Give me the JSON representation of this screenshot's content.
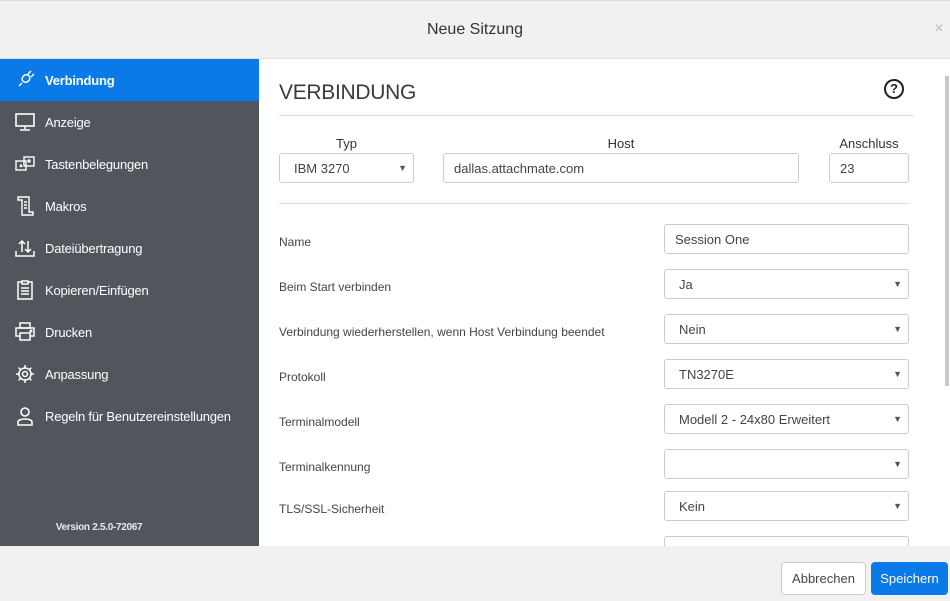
{
  "dialog": {
    "title": "Neue Sitzung",
    "close_symbol": "×"
  },
  "sidebar": {
    "items": [
      {
        "label": "Verbindung",
        "icon": "plug-icon",
        "active": true
      },
      {
        "label": "Anzeige",
        "icon": "monitor-icon",
        "active": false
      },
      {
        "label": "Tastenbelegungen",
        "icon": "keymap-icon",
        "active": false
      },
      {
        "label": "Makros",
        "icon": "scroll-icon",
        "active": false
      },
      {
        "label": "Dateiübertragung",
        "icon": "file-transfer-icon",
        "active": false
      },
      {
        "label": "Kopieren/Einfügen",
        "icon": "clipboard-icon",
        "active": false
      },
      {
        "label": "Drucken",
        "icon": "printer-icon",
        "active": false
      },
      {
        "label": "Anpassung",
        "icon": "gear-icon",
        "active": false
      },
      {
        "label": "Regeln für Benutzereinstellungen",
        "icon": "user-icon",
        "active": false
      }
    ],
    "version": "Version 2.5.0-72067"
  },
  "main": {
    "title": "VERBINDUNG",
    "help_symbol": "?",
    "type": {
      "label": "Typ",
      "value": "IBM 3270"
    },
    "host": {
      "label": "Host",
      "value": "dallas.attachmate.com"
    },
    "port": {
      "label": "Anschluss",
      "value": "23"
    },
    "rows": [
      {
        "label": "Name",
        "value": "Session One",
        "kind": "input"
      },
      {
        "label": "Beim Start verbinden",
        "value": "Ja",
        "kind": "select"
      },
      {
        "label": "Verbindung wiederherstellen, wenn Host Verbindung beendet",
        "value": "Nein",
        "kind": "select"
      },
      {
        "label": "Protokoll",
        "value": "TN3270E",
        "kind": "select"
      },
      {
        "label": "Terminalmodell",
        "value": "Modell 2 - 24x80 Erweitert",
        "kind": "select"
      },
      {
        "label": "Terminalkennung",
        "value": "",
        "kind": "select"
      },
      {
        "label": "TLS/SSL-Sicherheit",
        "value": "Kein",
        "kind": "select"
      }
    ],
    "caret_symbol": "▼"
  },
  "footer": {
    "cancel_label": "Abbrechen",
    "save_label": "Speichern"
  },
  "colors": {
    "accent": "#0a7ae9",
    "sidebar_bg": "#51555c",
    "header_bg": "#f1f1f1"
  }
}
